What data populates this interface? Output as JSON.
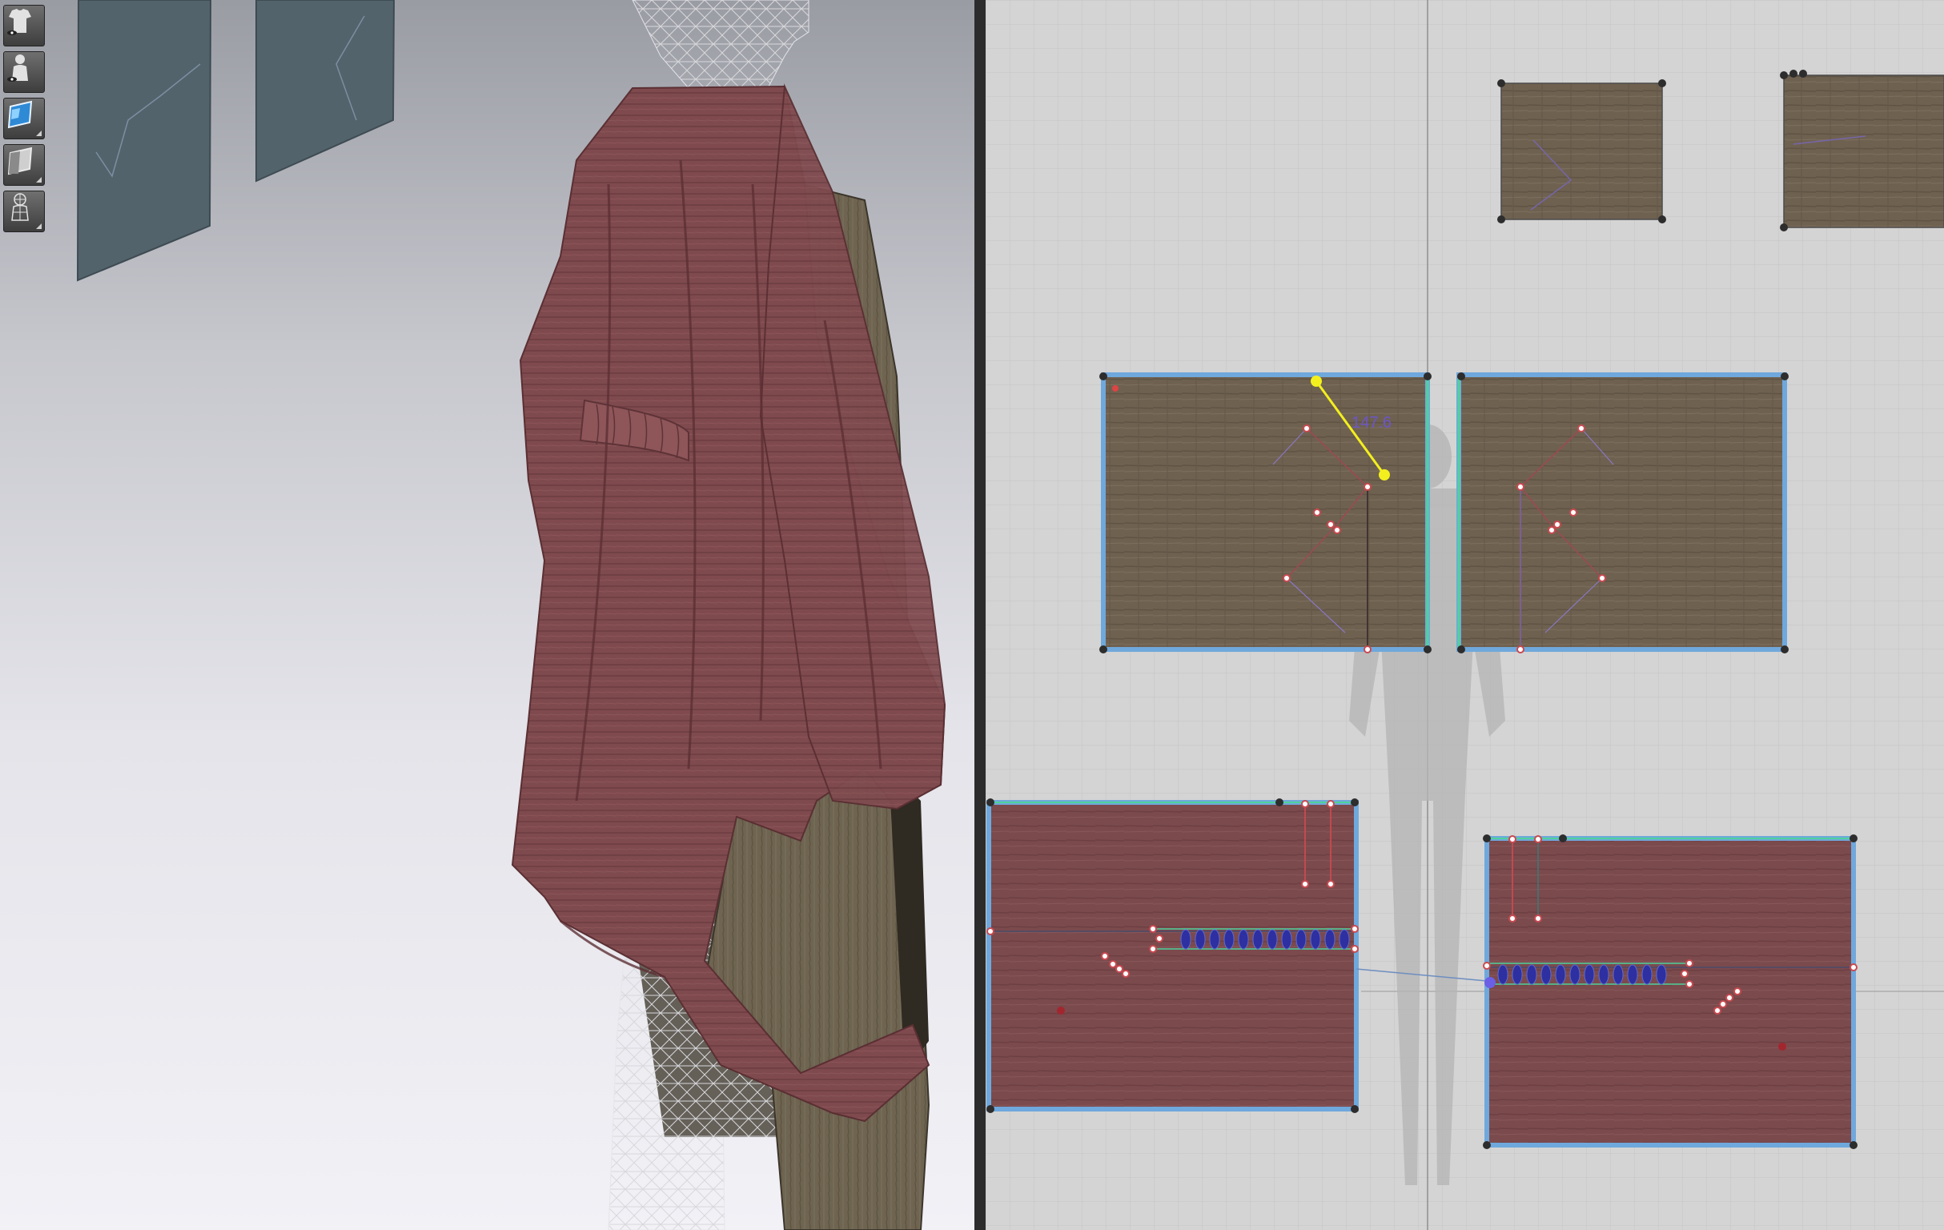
{
  "toolbar": {
    "tools": [
      {
        "name": "show-garment-tool",
        "icon": "garment-eye-icon"
      },
      {
        "name": "show-avatar-tool",
        "icon": "avatar-eye-icon"
      },
      {
        "name": "texture-view-tool",
        "icon": "texture-icon"
      },
      {
        "name": "shaded-view-tool",
        "icon": "shaded-surface-icon"
      },
      {
        "name": "avatar-mesh-tool",
        "icon": "avatar-mesh-icon"
      }
    ]
  },
  "pattern_view": {
    "measurement_label": "147.6"
  },
  "colors": {
    "bg_3d_top": "#9a9ca4",
    "bg_2d": "#d4d4d4",
    "grid": "#c2c2c2",
    "fabric_brown": "#6f6150",
    "fabric_red": "#7d4a4e",
    "selection_blue": "#6fa8dc",
    "measure_yellow": "#f3ef1e",
    "point_red": "#c94a50"
  }
}
